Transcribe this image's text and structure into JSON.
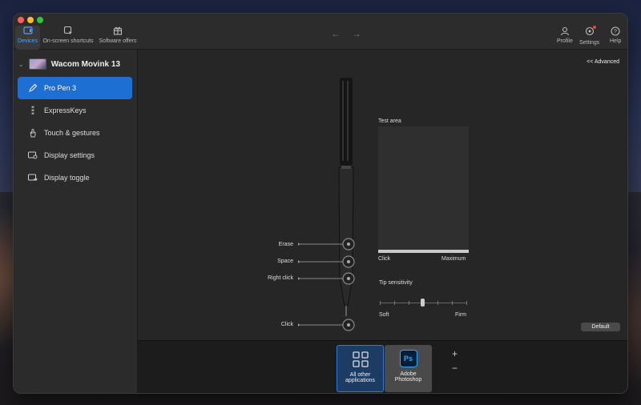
{
  "toolbar": {
    "tabs": [
      {
        "label": "Devices",
        "icon": "devices-icon"
      },
      {
        "label": "On-screen shortcuts",
        "icon": "shortcuts-icon"
      },
      {
        "label": "Software offers",
        "icon": "gift-icon"
      }
    ],
    "right": [
      {
        "label": "Profile",
        "icon": "profile-icon"
      },
      {
        "label": "Settings",
        "icon": "gear-icon"
      },
      {
        "label": "Help",
        "icon": "help-icon"
      }
    ],
    "accent_color": "#4da3ff",
    "notification_color": "#ff3b30"
  },
  "sidebar": {
    "device_name": "Wacom Movink 13",
    "items": [
      {
        "label": "Pro Pen 3",
        "icon": "pen-icon",
        "active": true
      },
      {
        "label": "ExpressKeys",
        "icon": "expresskeys-icon"
      },
      {
        "label": "Touch & gestures",
        "icon": "hand-icon"
      },
      {
        "label": "Display settings",
        "icon": "display-settings-icon"
      },
      {
        "label": "Display toggle",
        "icon": "display-toggle-icon"
      }
    ],
    "active_color": "#1e6fd4"
  },
  "main": {
    "advanced_link": "<< Advanced",
    "pen_buttons": [
      "Erase",
      "Space",
      "Right click",
      "Click"
    ],
    "test_area": {
      "title": "Test area",
      "left_label": "Click",
      "right_label": "Maximum"
    },
    "tip_sensitivity": {
      "title": "Tip sensitivity",
      "soft_label": "Soft",
      "firm_label": "Firm",
      "level": 0.5
    },
    "default_button": "Default"
  },
  "apps": [
    {
      "label_line1": "All other",
      "label_line2": "applications",
      "icon": "grid-icon",
      "selected": true
    },
    {
      "label_line1": "Adobe",
      "label_line2": "Photoshop",
      "icon": "photoshop-icon",
      "icon_text": "Ps",
      "selected": false
    }
  ],
  "app_controls": {
    "add": "+",
    "remove": "−"
  }
}
